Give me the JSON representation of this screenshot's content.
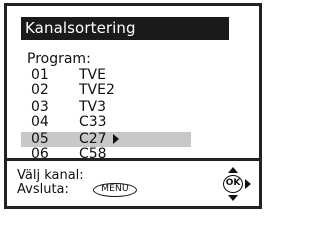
{
  "title": "Kanalsortering",
  "program_label": "Program:",
  "channels": [
    {
      "number": "01",
      "name": "TVE"
    },
    {
      "number": "02",
      "name": "TVE2"
    },
    {
      "number": "03",
      "name": "TV3"
    },
    {
      "number": "04",
      "name": "C33"
    },
    {
      "number": "05",
      "name": "C27"
    },
    {
      "number": "06",
      "name": "C58"
    }
  ],
  "selected_channel": "05",
  "footer": {
    "select_label": "Välj kanal:",
    "exit_label": "Avsluta:",
    "menu_button": "MENU",
    "ok_button": "OK"
  },
  "colors": {
    "title_bar": "#1a1a1a",
    "selected_row": "#c8c8c8"
  }
}
